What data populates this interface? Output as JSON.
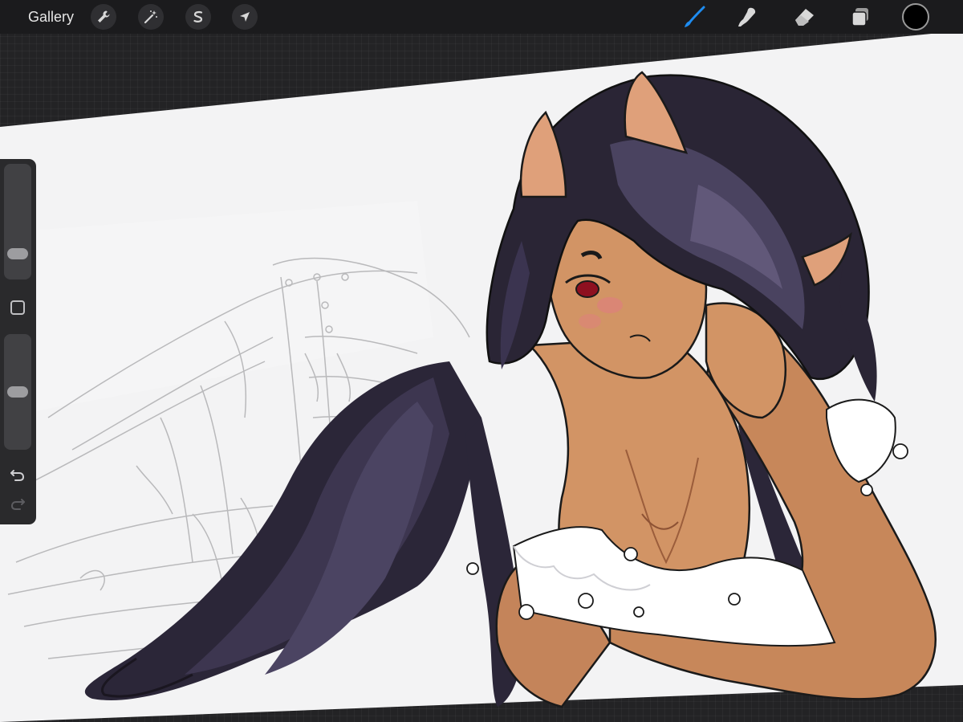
{
  "toolbar": {
    "gallery_label": "Gallery",
    "actions_icon": "wrench-icon",
    "adjustments_icon": "magic-wand-icon",
    "selection_icon": "selection-s-icon",
    "transform_icon": "arrow-cursor-icon",
    "brush_icon": "brush-icon",
    "smudge_icon": "smudge-icon",
    "eraser_icon": "eraser-icon",
    "layers_icon": "layers-icon",
    "active_tool": "brush",
    "accent_color": "#1e8cf0",
    "current_color": "#000000"
  },
  "sidebar": {
    "brush_size_level": 0.17,
    "opacity_level": 0.5,
    "modify_icon": "square-icon",
    "undo_icon": "undo-icon",
    "redo_icon": "redo-icon"
  },
  "canvas": {
    "background_color": "#f3f3f4",
    "content": "illustration-of-horned-girl-with-long-dark-hair"
  }
}
